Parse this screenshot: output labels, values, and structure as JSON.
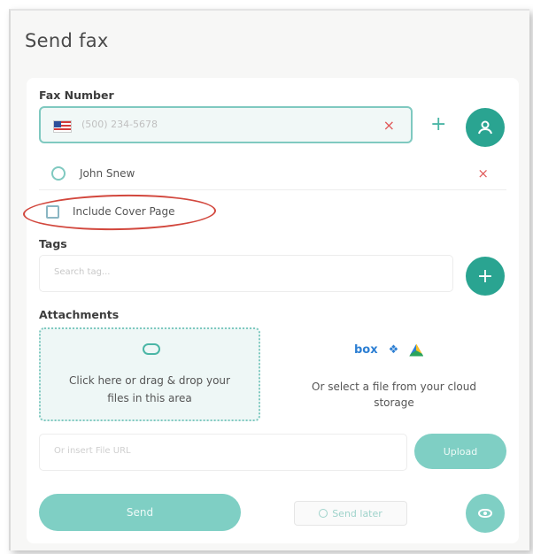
{
  "window": {
    "title": "Send fax"
  },
  "fax": {
    "label": "Fax Number",
    "placeholder": "(500) 234-5678",
    "country_flag": "us-flag-icon",
    "clear_icon": "×"
  },
  "recipients": [
    {
      "name": "John Snew",
      "remove_icon": "×"
    }
  ],
  "cover_page": {
    "label": "Include Cover Page",
    "checked": false
  },
  "tags": {
    "label": "Tags",
    "placeholder": "Search tag..."
  },
  "attachments": {
    "label": "Attachments",
    "drop_text": "Click here or drag & drop your files in this area",
    "cloud_text": "Or select a file from your cloud storage",
    "cloud_providers": [
      "box",
      "dropbox",
      "google-drive"
    ],
    "box_label": "box",
    "url_placeholder": "Or insert File URL",
    "upload_label": "Upload"
  },
  "actions": {
    "send_label": "Send",
    "send_later_label": "Send later"
  },
  "colors": {
    "accent": "#2aa491",
    "accent_light": "#7fcfc4",
    "danger": "#e05a5a",
    "highlight_ellipse": "#d2473d"
  }
}
